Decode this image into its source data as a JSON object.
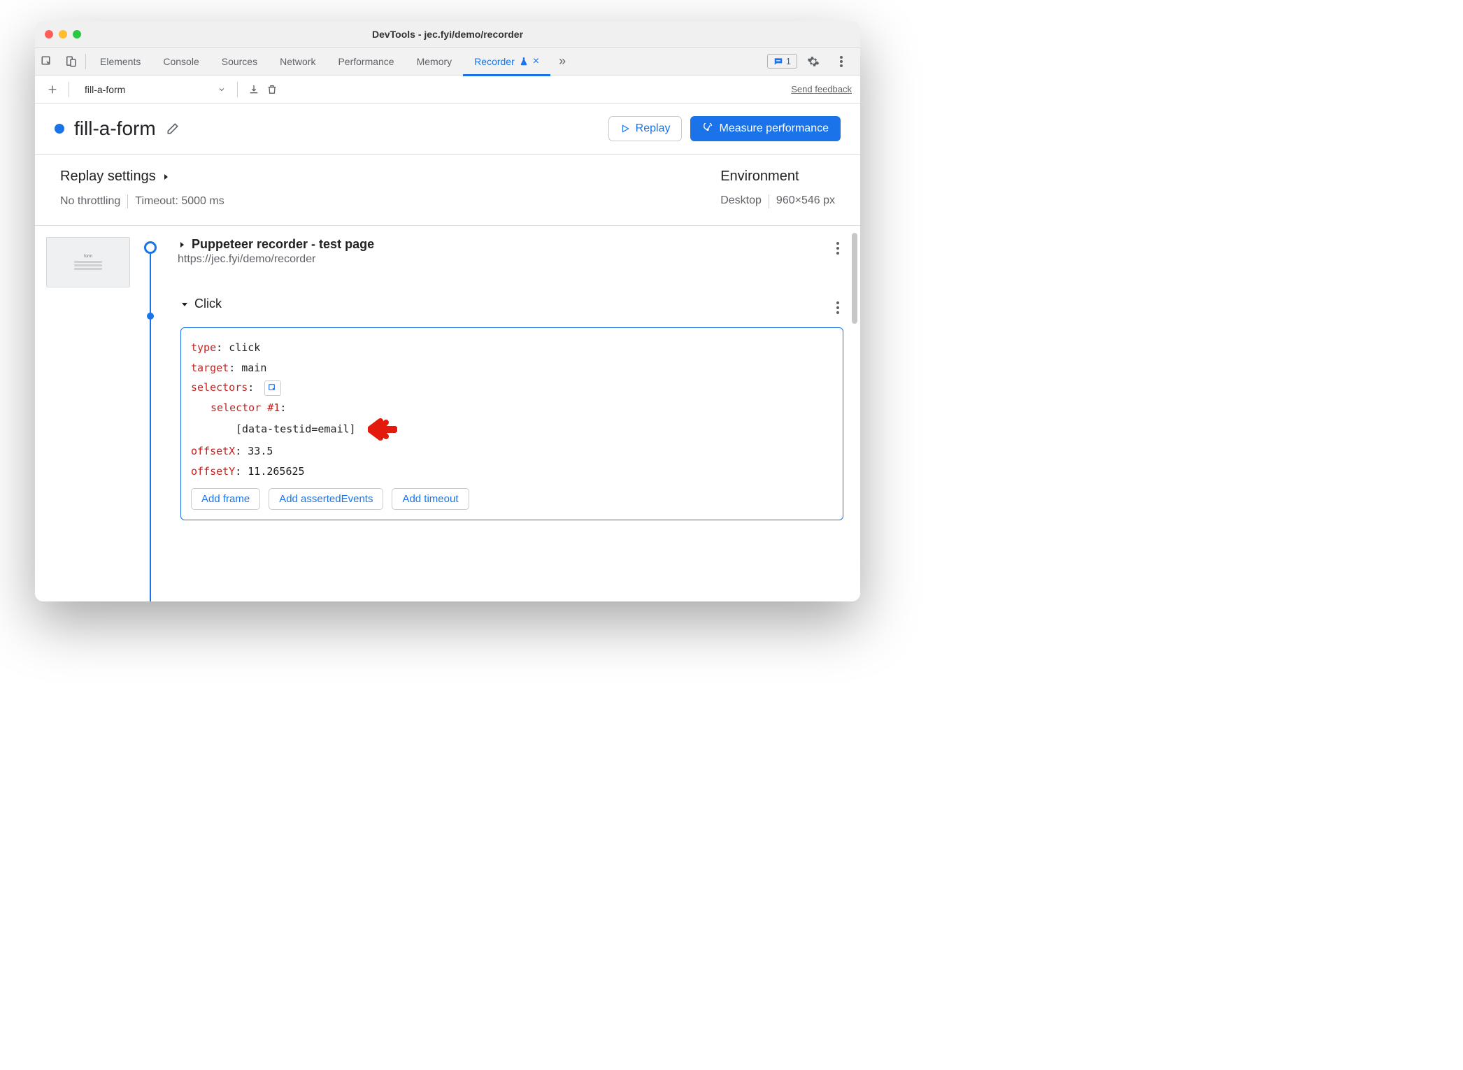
{
  "window_title": "DevTools - jec.fyi/demo/recorder",
  "tabs": {
    "elements": "Elements",
    "console": "Console",
    "sources": "Sources",
    "network": "Network",
    "performance": "Performance",
    "memory": "Memory",
    "recorder": "Recorder"
  },
  "issues_count": "1",
  "toolbar": {
    "recording_name": "fill-a-form",
    "feedback": "Send feedback"
  },
  "header": {
    "title": "fill-a-form",
    "replay": "Replay",
    "measure": "Measure performance"
  },
  "settings": {
    "title": "Replay settings",
    "throttle": "No throttling",
    "timeout": "Timeout: 5000 ms",
    "env_title": "Environment",
    "device": "Desktop",
    "viewport": "960×546 px"
  },
  "steps": {
    "first_title": "Puppeteer recorder - test page",
    "first_url": "https://jec.fyi/demo/recorder",
    "click": {
      "label": "Click",
      "type_key": "type",
      "type_val": "click",
      "target_key": "target",
      "target_val": "main",
      "selectors_key": "selectors",
      "selector1_key": "selector #1",
      "selector1_val": "[data-testid=email]",
      "offsetX_key": "offsetX",
      "offsetX_val": "33.5",
      "offsetY_key": "offsetY",
      "offsetY_val": "11.265625",
      "add_frame": "Add frame",
      "add_asserted": "Add assertedEvents",
      "add_timeout": "Add timeout"
    }
  }
}
